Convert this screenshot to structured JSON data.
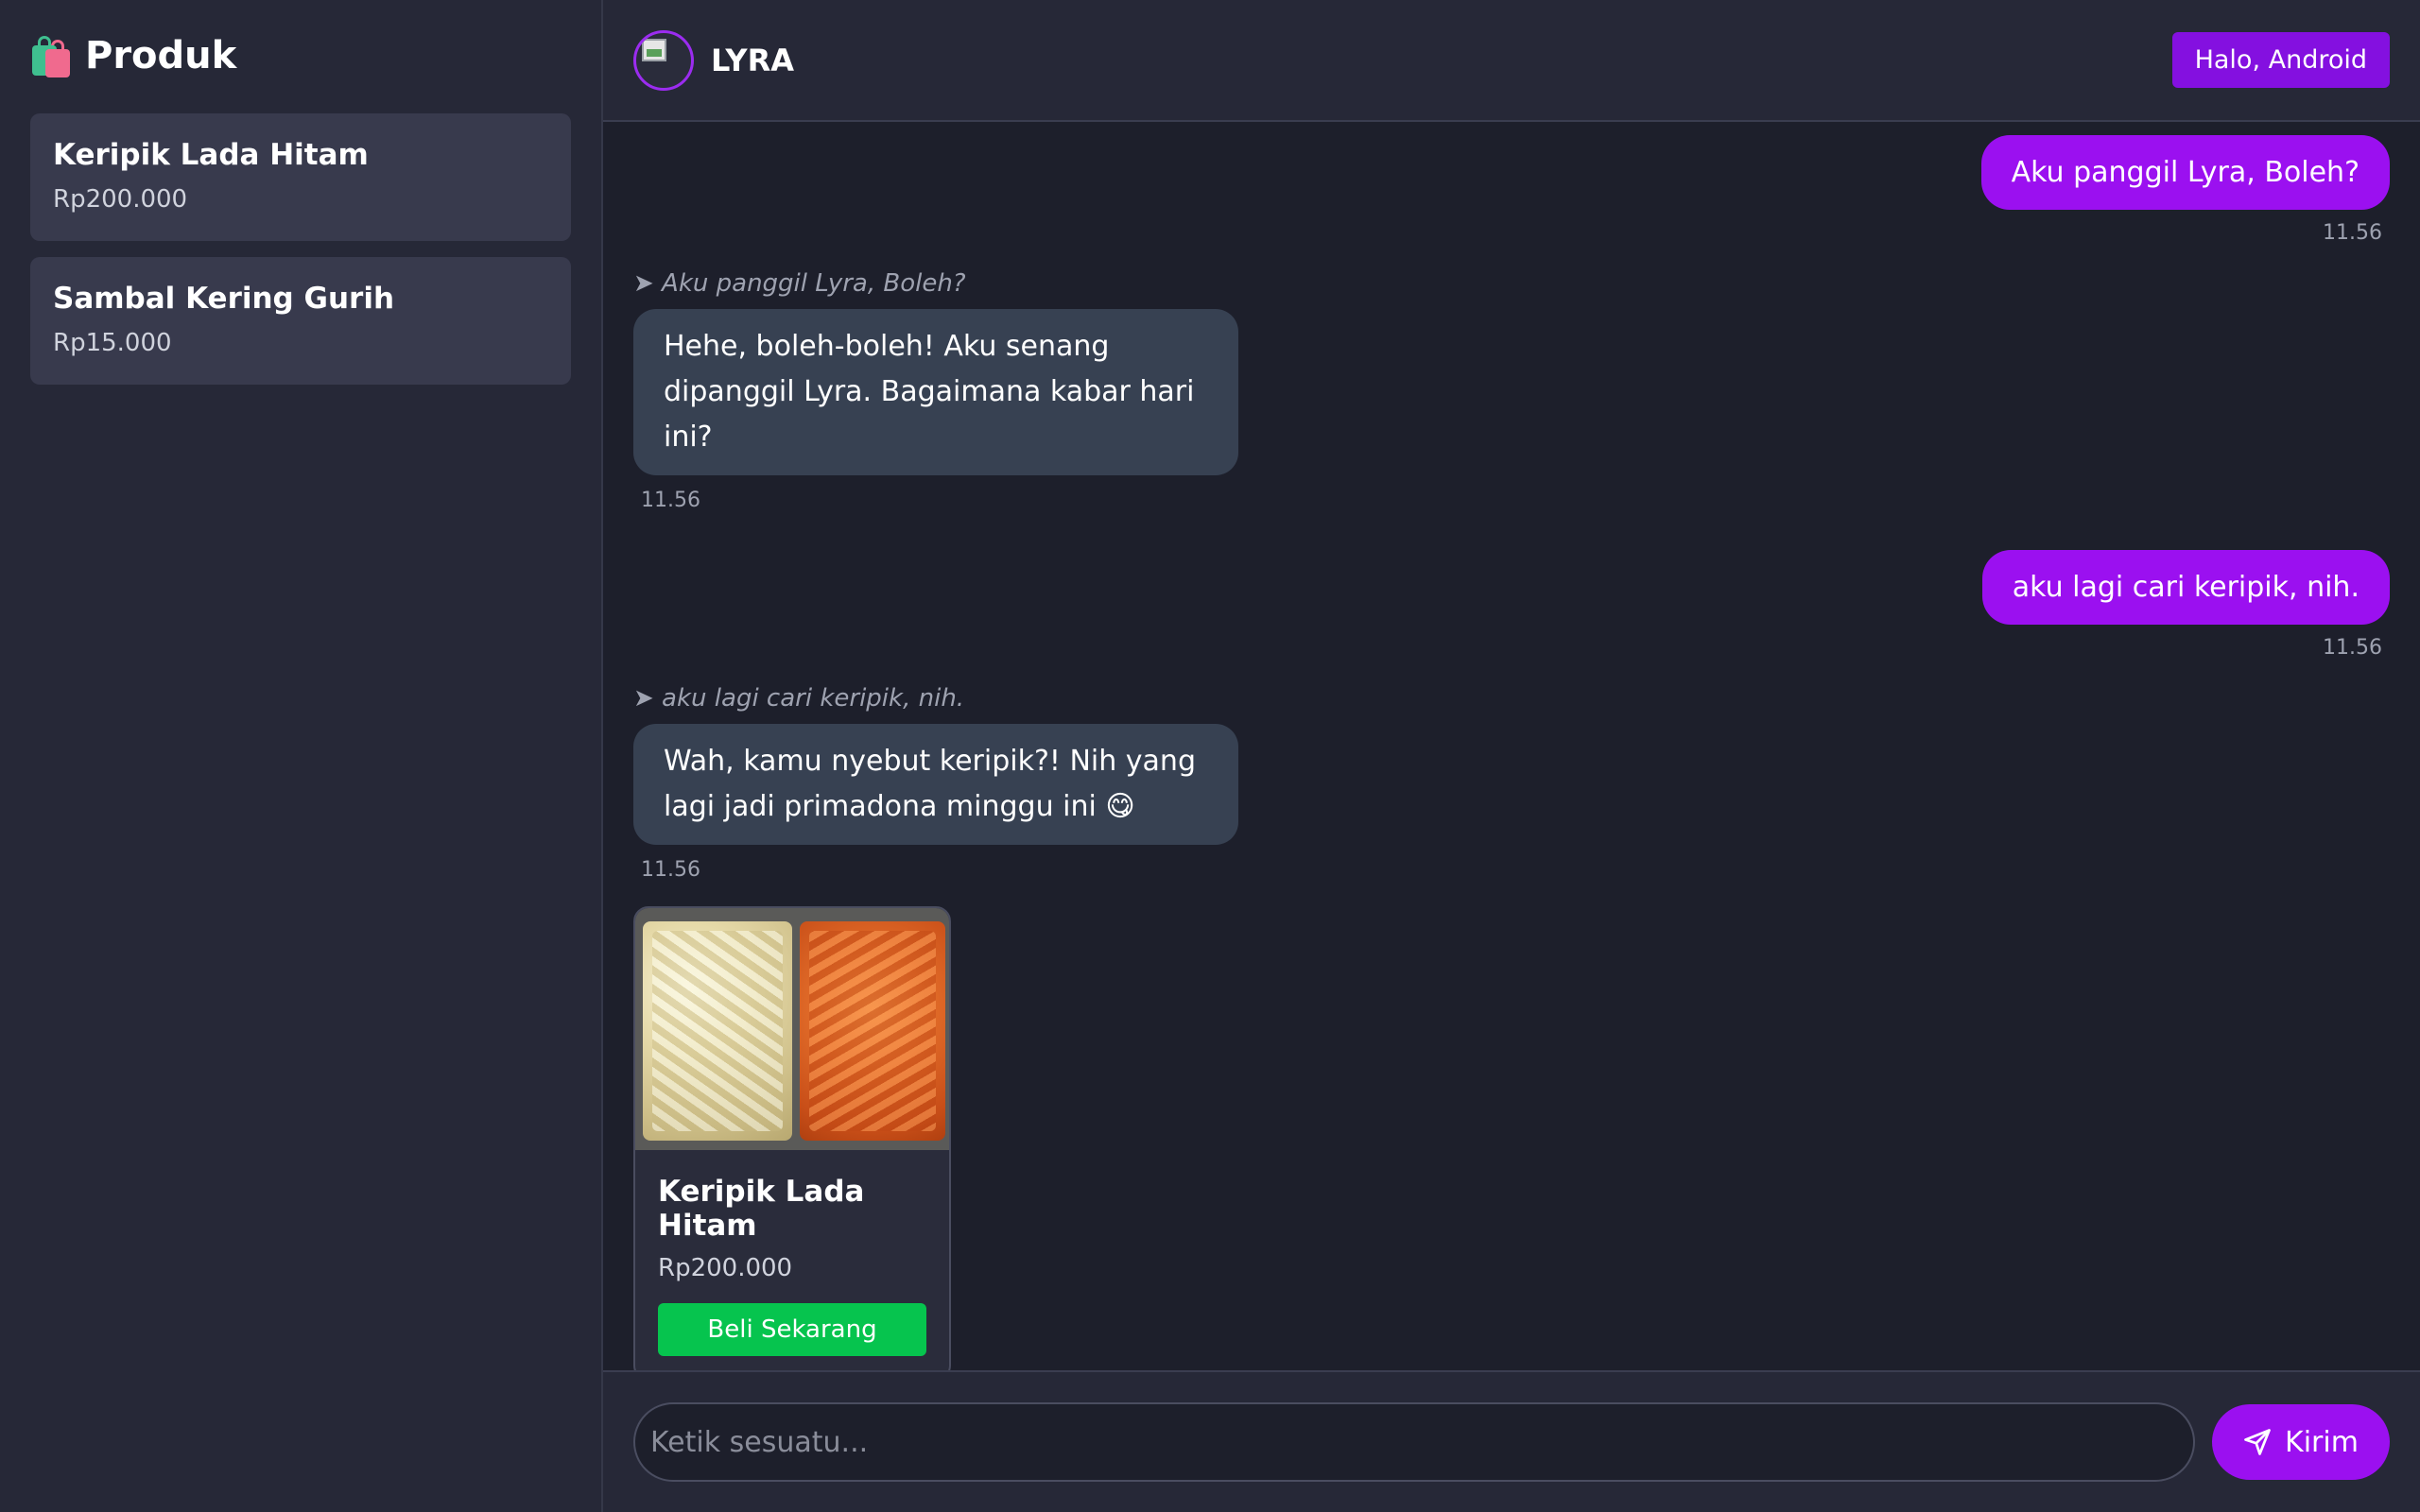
{
  "sidebar": {
    "title": "Produk",
    "items": [
      {
        "name": "Keripik Lada Hitam",
        "price": "Rp200.000"
      },
      {
        "name": "Sambal Kering Gurih",
        "price": "Rp15.000"
      }
    ]
  },
  "header": {
    "bot_name": "LYRA",
    "greeting": "Halo, Android"
  },
  "messages": [
    {
      "from": "user",
      "text": "Aku panggil Lyra, Boleh?",
      "time": "11.56"
    },
    {
      "from": "bot",
      "quote": "➤ Aku panggil Lyra, Boleh?",
      "text": "Hehe, boleh-boleh! Aku senang dipanggil Lyra. Bagaimana kabar hari ini?",
      "time": "11.56"
    },
    {
      "from": "user",
      "text": "aku lagi cari keripik, nih.",
      "time": "11.56"
    },
    {
      "from": "bot",
      "quote": "➤ aku lagi cari keripik, nih.",
      "text": "Wah, kamu nyebut keripik?! Nih yang lagi jadi primadona minggu ini 😋",
      "time": "11.56"
    }
  ],
  "product_card": {
    "name": "Keripik Lada Hitam",
    "price": "Rp200.000",
    "buy_label": "Beli Sekarang"
  },
  "composer": {
    "placeholder": "Ketik sesuatu...",
    "send_label": "Kirim"
  },
  "colors": {
    "accent": "#9b10f0",
    "buy": "#06c44e",
    "sidebar_bg": "#262837",
    "main_bg": "#1d1f2b"
  }
}
